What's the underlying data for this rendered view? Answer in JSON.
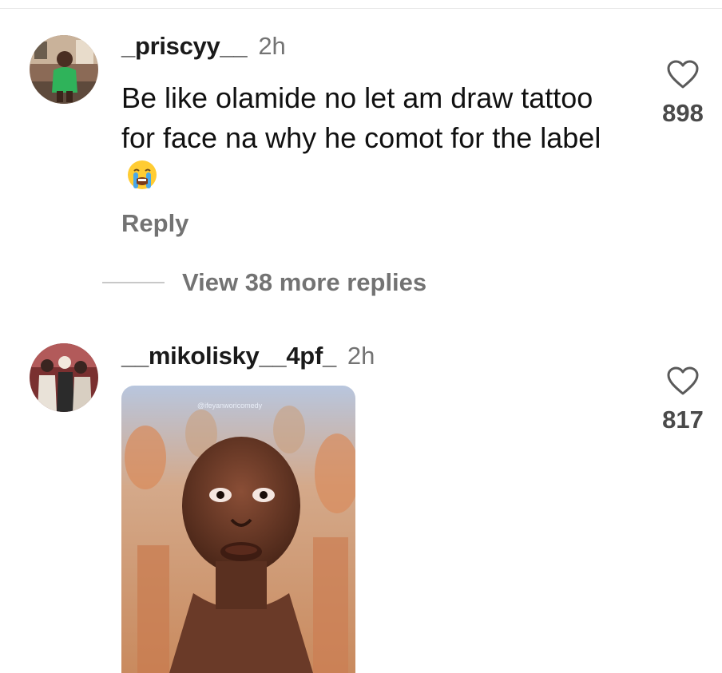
{
  "comments": [
    {
      "username": "_priscyy__",
      "time": "2h",
      "text": "Be like olamide no let am draw tattoo for face na why he comot for the label",
      "emoji": "loudly-crying-face",
      "likes": "898",
      "reply_label": "Reply"
    },
    {
      "username": "__mikolisky__4pf_",
      "time": "2h",
      "likes": "817",
      "media_watermark": "@ifeyanworicomedy"
    }
  ],
  "view_more_replies": "View 38 more replies",
  "colors": {
    "text": "#111111",
    "muted": "#737373",
    "divider": "#c8c8c8"
  }
}
